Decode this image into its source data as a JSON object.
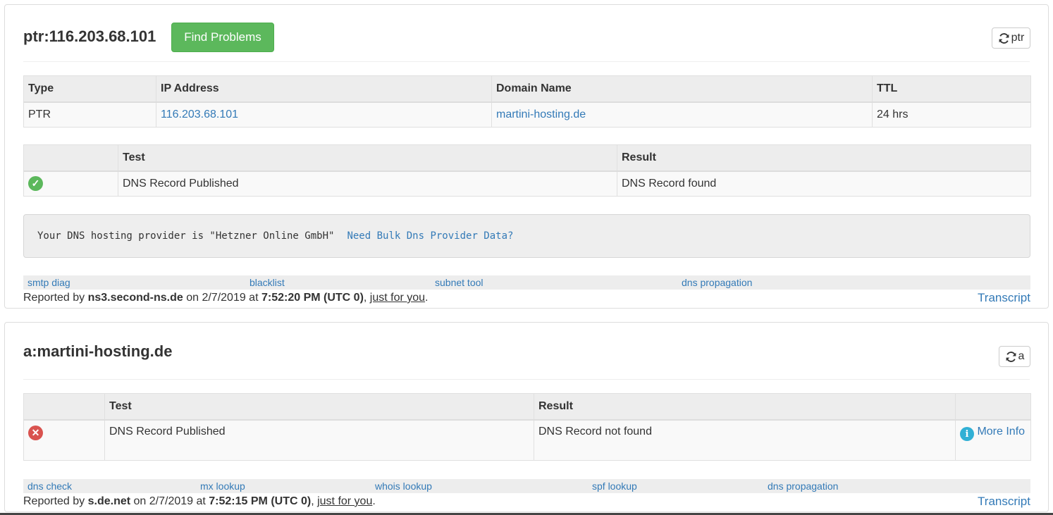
{
  "ptr_panel": {
    "title": "ptr:116.203.68.101",
    "find_button": "Find Problems",
    "refresh_label": "ptr",
    "record_table": {
      "headers": [
        "Type",
        "IP Address",
        "Domain Name",
        "TTL"
      ],
      "row": {
        "type": "PTR",
        "ip": "116.203.68.101",
        "domain": "martini-hosting.de",
        "ttl": "24 hrs"
      }
    },
    "test_table": {
      "headers": [
        "",
        "Test",
        "Result"
      ],
      "row": {
        "status": "ok",
        "test": "DNS Record Published",
        "result": "DNS Record found"
      }
    },
    "provider_text": "Your DNS hosting provider is \"Hetzner Online GmbH\"",
    "bulk_link": "Need Bulk Dns Provider Data?",
    "links": [
      "smtp diag",
      "blacklist",
      "subnet tool",
      "dns propagation"
    ],
    "reported": {
      "prefix": "Reported by ",
      "server": "ns3.second-ns.de",
      "on": " on 2/7/2019 at ",
      "time": "7:52:20 PM (UTC 0)",
      "comma": ", ",
      "just": "just for you",
      "end": "."
    },
    "transcript": "Transcript"
  },
  "a_panel": {
    "title": "a:martini-hosting.de",
    "refresh_label": "a",
    "test_table": {
      "headers": [
        "",
        "Test",
        "Result",
        ""
      ],
      "row": {
        "status": "error",
        "test": "DNS Record Published",
        "result": "DNS Record not found",
        "more": "More Info"
      }
    },
    "links": [
      "dns check",
      "mx lookup",
      "whois lookup",
      "spf lookup",
      "dns propagation"
    ],
    "reported": {
      "prefix": "Reported by ",
      "server": "s.de.net",
      "on": " on 2/7/2019 at ",
      "time": "7:52:15 PM (UTC 0)",
      "comma": ", ",
      "just": "just for you",
      "end": "."
    },
    "transcript": "Transcript"
  },
  "colors": {
    "link": "#337ab7",
    "success": "#5cb85c",
    "danger": "#d9534f",
    "info": "#31b0d5"
  },
  "icons": [
    "refresh-icon",
    "check-circle-icon",
    "error-circle-icon",
    "info-circle-icon"
  ]
}
